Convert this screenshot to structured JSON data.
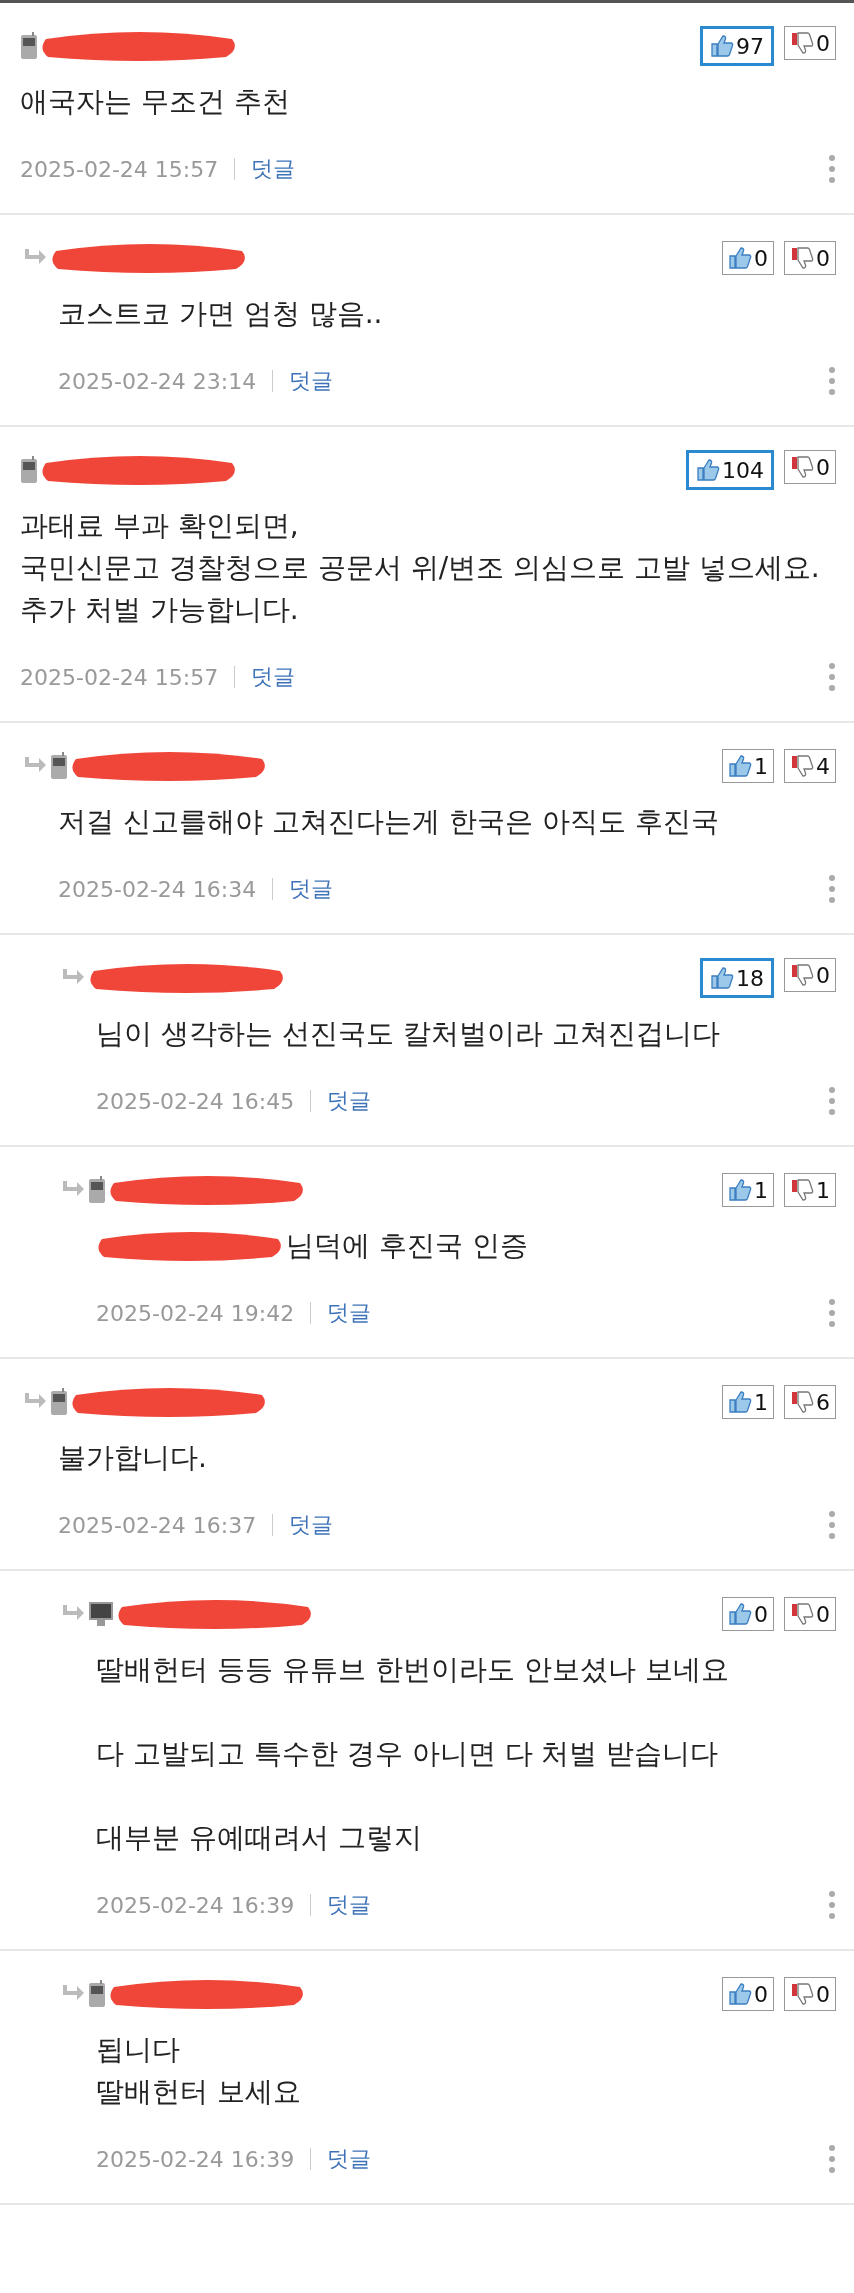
{
  "comments": [
    {
      "kind": "phone",
      "text": "애국자는 무조건 추천",
      "likes": "97",
      "best": true,
      "dislikes": "0",
      "date": "2025-02-24 15:57",
      "reply_label": "덧글",
      "children": [
        {
          "text": "코스트코 가면 엄청 많음..",
          "likes": "0",
          "best": false,
          "dislikes": "0",
          "date": "2025-02-24 23:14",
          "reply_label": "덧글"
        }
      ]
    },
    {
      "kind": "phone",
      "text": "과태료 부과 확인되면,\n국민신문고 경찰청으로 공문서 위/변조 의심으로 고발 넣으세요.\n추가 처벌 가능합니다.",
      "likes": "104",
      "best": true,
      "dislikes": "0",
      "date": "2025-02-24 15:57",
      "reply_label": "덧글",
      "children": [
        {
          "kind": "phone",
          "text": "저걸 신고를해야 고쳐진다는게 한국은 아직도 후진국",
          "likes": "1",
          "best": false,
          "dislikes": "4",
          "date": "2025-02-24 16:34",
          "reply_label": "덧글",
          "children": [
            {
              "text": "님이 생각하는 선진국도 칼처벌이라 고쳐진겁니다",
              "likes": "18",
              "best": true,
              "dislikes": "0",
              "date": "2025-02-24 16:45",
              "reply_label": "덧글"
            },
            {
              "kind": "phone",
              "redacted_prefix": true,
              "text": "님덕에 후진국 인증",
              "likes": "1",
              "best": false,
              "dislikes": "1",
              "date": "2025-02-24 19:42",
              "reply_label": "덧글"
            }
          ]
        },
        {
          "kind": "phone",
          "text": "불가합니다.",
          "likes": "1",
          "best": false,
          "dislikes": "6",
          "date": "2025-02-24 16:37",
          "reply_label": "덧글",
          "children": [
            {
              "kind": "monitor",
              "text": "딸배헌터 등등 유튜브 한번이라도 안보셨나 보네요\n\n다 고발되고 특수한 경우 아니면 다 처벌 받습니다\n\n대부분 유예때려서 그렇지",
              "likes": "0",
              "best": false,
              "dislikes": "0",
              "date": "2025-02-24 16:39",
              "reply_label": "덧글"
            },
            {
              "kind": "phone",
              "text": "됩니다\n딸배헌터 보세요",
              "likes": "0",
              "best": false,
              "dislikes": "0",
              "date": "2025-02-24 16:39",
              "reply_label": "덧글"
            }
          ]
        }
      ]
    }
  ]
}
